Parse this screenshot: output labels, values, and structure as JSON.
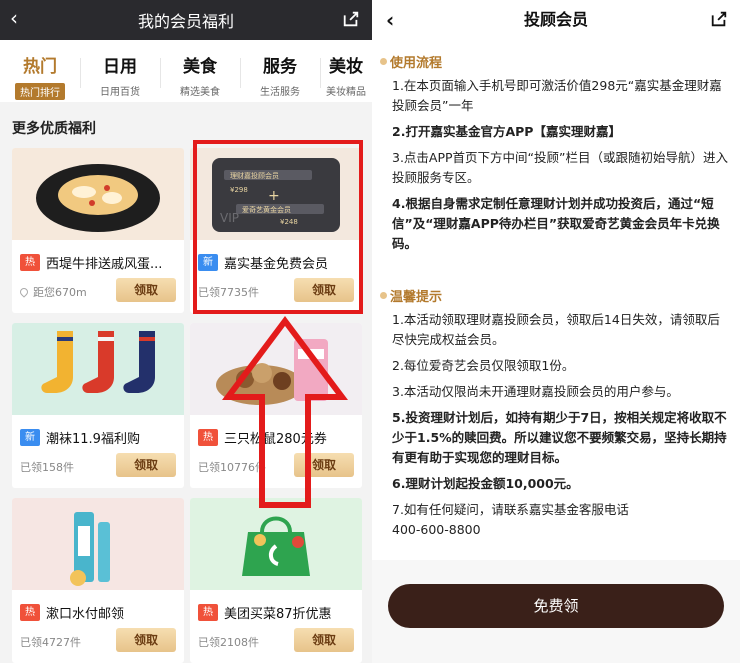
{
  "left": {
    "header": {
      "title": "我的会员福利"
    },
    "categories": [
      {
        "title": "热门",
        "subtitle": "热门排行"
      },
      {
        "title": "日用",
        "subtitle": "日用百货"
      },
      {
        "title": "美食",
        "subtitle": "精选美食"
      },
      {
        "title": "服务",
        "subtitle": "生活服务"
      },
      {
        "title": "美妆",
        "subtitle": "美妆精品"
      }
    ],
    "section_title": "更多优质福利",
    "cards": [
      {
        "badge": "热",
        "badge_type": "hot",
        "title": "西堤牛排送戚风蛋...",
        "meta": "距您670m",
        "button": "领取"
      },
      {
        "badge": "新",
        "badge_type": "new",
        "title": "嘉实基金免费会员",
        "meta": "已领7735件",
        "button": "领取"
      },
      {
        "badge": "新",
        "badge_type": "new",
        "title": "潮袜11.9福利购",
        "meta": "已领158件",
        "button": "领取"
      },
      {
        "badge": "热",
        "badge_type": "hot",
        "title": "三只松鼠280元券",
        "meta": "已领10776件",
        "button": "领取"
      },
      {
        "badge": "热",
        "badge_type": "hot",
        "title": "漱口水付邮领",
        "meta": "已领4727件",
        "button": "领取"
      },
      {
        "badge": "热",
        "badge_type": "hot",
        "title": "美团买菜87折优惠",
        "meta": "已领2108件",
        "button": "领取"
      }
    ],
    "card_image_text": {
      "card_line1": "理财嘉投顾会员",
      "price1": "¥298",
      "card_line2": "爱奇艺黄金会员",
      "price2": "¥248",
      "vip": "VIP"
    }
  },
  "right": {
    "header": {
      "title": "投顾会员"
    },
    "section1": {
      "title": "使用流程",
      "items": [
        "1.在本页面输入手机号即可激活价值298元“嘉实基金理财嘉投顾会员”一年",
        "2.打开嘉实基金官方APP【嘉实理财嘉】",
        "3.点击APP首页下方中间“投顾”栏目（或跟随初始导航）进入投顾服务专区。",
        "4.根据自身需求定制任意理财计划并成功投资后，通过“短信”及“理财嘉APP待办栏目”获取爱奇艺黄金会员年卡兑换码。"
      ]
    },
    "section2": {
      "title": "温馨提示",
      "items": [
        "1.本活动领取理财嘉投顾会员，领取后14日失效，请领取后尽快完成权益会员。",
        "2.每位爱奇艺会员仅限领取1份。",
        "3.本活动仅限尚未开通理财嘉投顾会员的用户参与。",
        "5.投资理财计划后，如持有期少于7日，按相关规定将收取不少于1.5%的赎回费。所以建议您不要频繁交易，坚持长期持有更有助于实现您的理财目标。",
        "6.理财计划起投金额10,000元。",
        "7.如有任何疑问，请联系嘉实基金客服电话",
        "400-600-8800"
      ]
    },
    "bottom_button": "免费领"
  }
}
